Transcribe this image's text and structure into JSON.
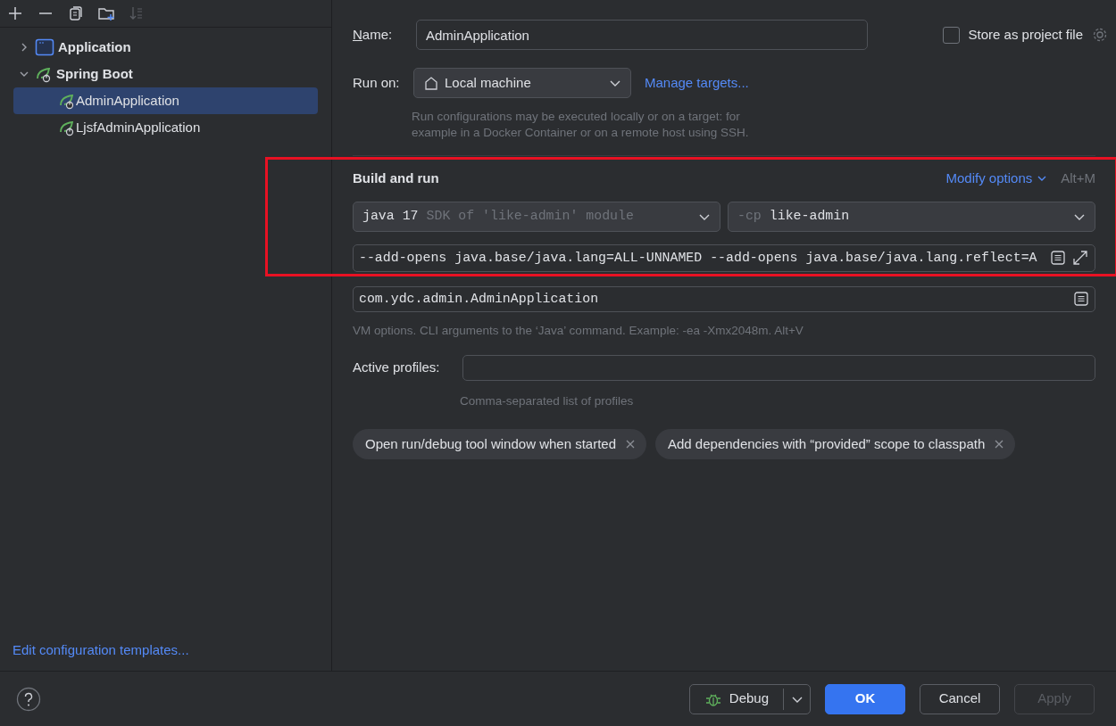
{
  "toolbar": [
    {
      "disabled": false
    },
    {
      "disabled": false
    },
    {
      "disabled": false
    },
    {
      "disabled": false
    },
    {
      "disabled": true
    }
  ],
  "tree": [
    {
      "label": "Application",
      "kind": "application",
      "expanded": false
    },
    {
      "label": "Spring Boot",
      "kind": "spring",
      "expanded": true,
      "children": [
        {
          "label": "AdminApplication",
          "selected": true
        },
        {
          "label": "LjsfAdminApplication",
          "selected": false
        }
      ]
    }
  ],
  "templates_link": "Edit configuration templates...",
  "name": {
    "label": "Name:",
    "value": "AdminApplication"
  },
  "store_as_project_file": {
    "label": "Store as project file",
    "checked": false
  },
  "run_on": {
    "label": "Run on:",
    "value": "Local machine",
    "link": "Manage targets...",
    "hint": "Run configurations may be executed locally or on a target: for example in a Docker Container or on a remote host using SSH."
  },
  "build_and_run": {
    "title": "Build and run",
    "highlighted": true,
    "modify_options": "Modify options",
    "shortcut": "Alt+M",
    "jre": {
      "value": "java 17",
      "hint": "SDK of 'like-admin' module"
    },
    "classpath": {
      "prefix": "-cp",
      "value": "like-admin"
    },
    "vm_options": "--add-opens java.base/java.lang=ALL-UNNAMED --add-opens java.base/java.lang.reflect=A",
    "main_class": "com.ydc.admin.AdminApplication",
    "hint": "VM options. CLI arguments to the ‘Java’ command. Example: -ea -Xmx2048m. Alt+V"
  },
  "active_profiles": {
    "label": "Active profiles:",
    "hint": "Comma-separated list of profiles"
  },
  "options": [
    "Open run/debug tool window when started",
    "Add dependencies with “provided” scope to classpath"
  ],
  "buttons": [
    {
      "label": "Debug",
      "kind": "split"
    },
    {
      "label": "OK",
      "kind": "primary",
      "disabled": false
    },
    {
      "label": "Cancel",
      "kind": "default",
      "disabled": false
    },
    {
      "label": "Apply",
      "kind": "default",
      "disabled": true
    }
  ]
}
